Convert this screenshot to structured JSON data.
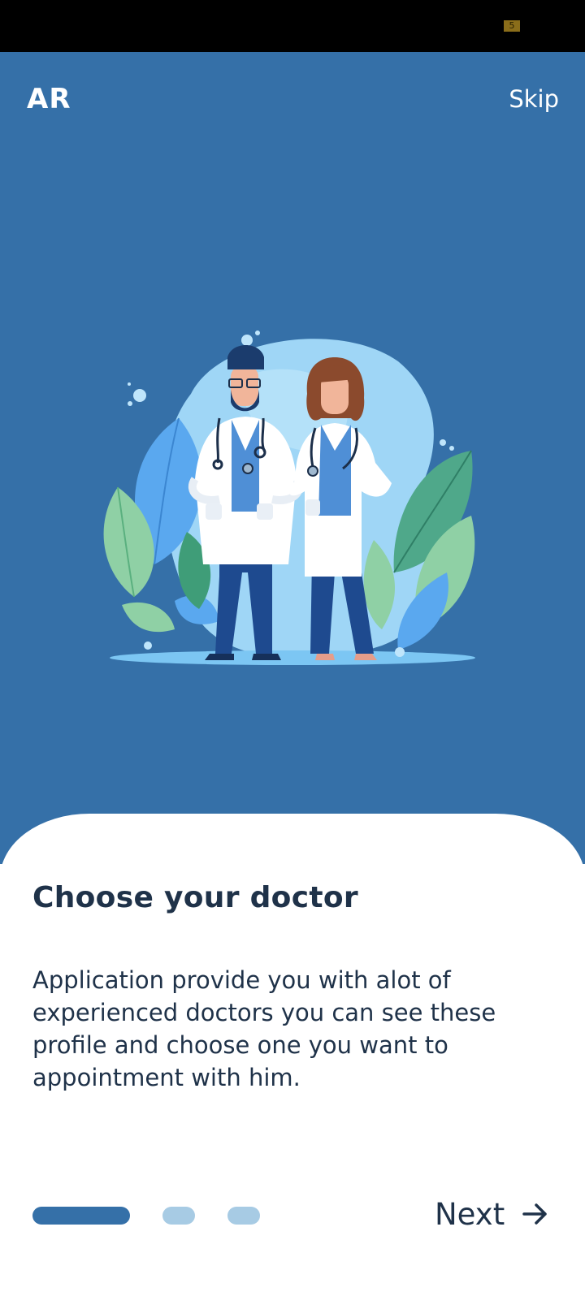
{
  "status_bar": {
    "badge": "5"
  },
  "header": {
    "brand": "AR",
    "skip_label": "Skip"
  },
  "illustration": {
    "icon": "doctors-illustration"
  },
  "content": {
    "title": "Choose your doctor",
    "description": "Application provide you with alot of experienced doctors you can see these profile and choose one you want to appointment with him."
  },
  "pagination": {
    "count": 3,
    "active_index": 0
  },
  "footer": {
    "next_label": "Next",
    "next_icon": "arrow-right-icon"
  },
  "colors": {
    "primary": "#3570a8",
    "text_dark": "#1f3249",
    "indicator_inactive": "#a7cbe4",
    "sheet": "#ffffff"
  }
}
